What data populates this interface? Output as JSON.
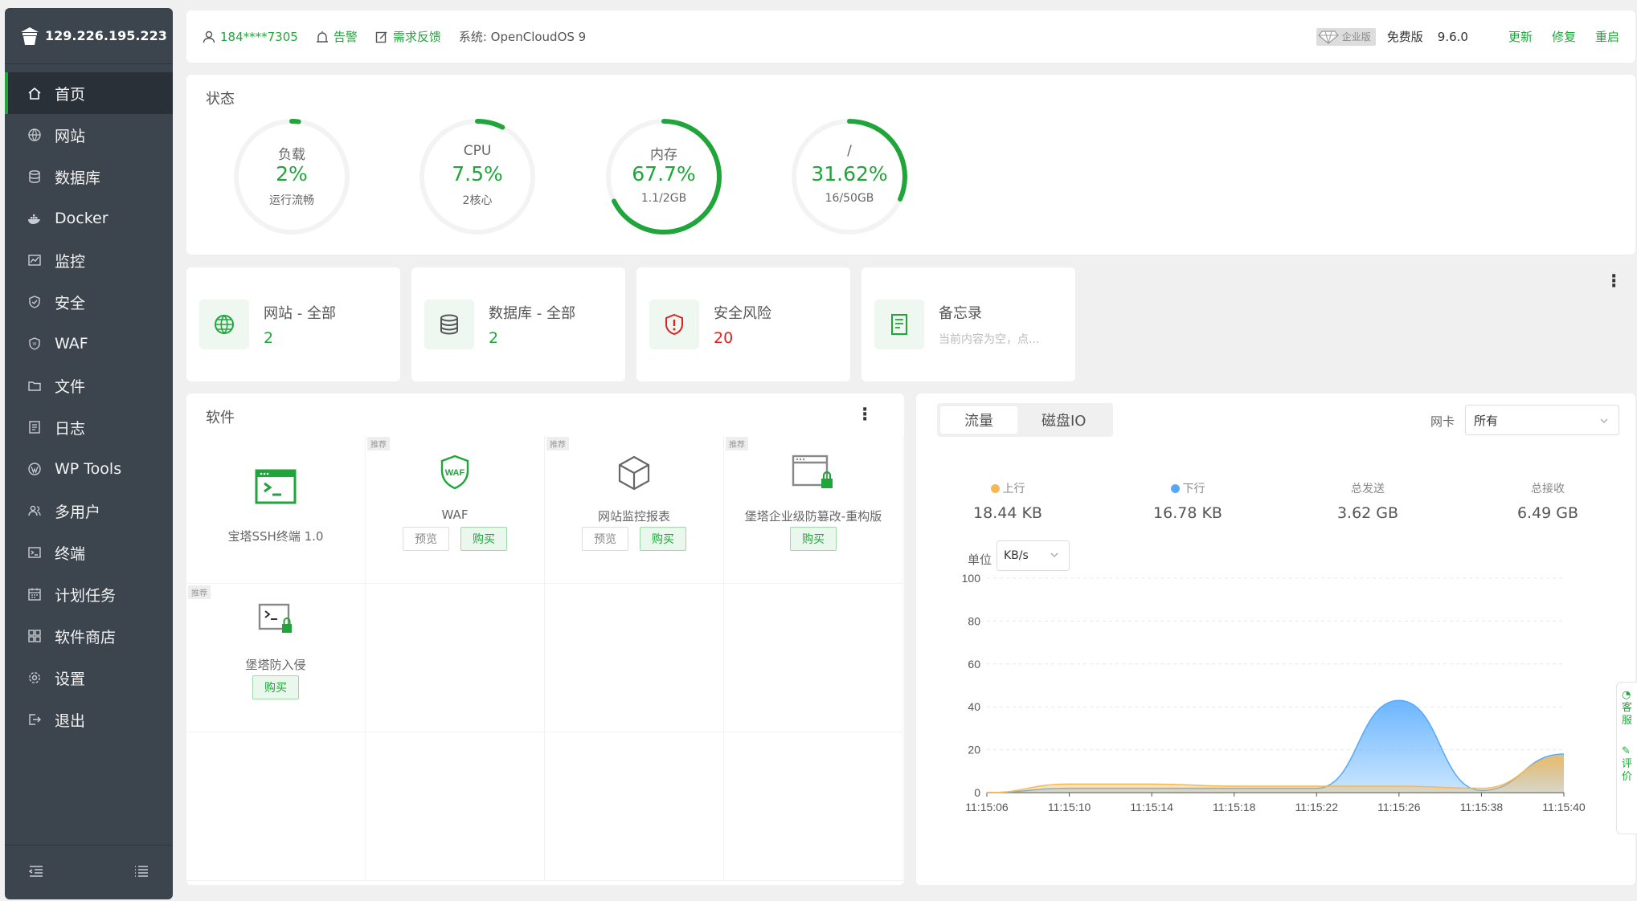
{
  "sidebar": {
    "ip": "129.226.195.223",
    "badge": "0",
    "items": [
      {
        "label": "首页",
        "icon": "home-icon"
      },
      {
        "label": "网站",
        "icon": "globe-icon"
      },
      {
        "label": "数据库",
        "icon": "database-icon"
      },
      {
        "label": "Docker",
        "icon": "docker-icon"
      },
      {
        "label": "监控",
        "icon": "monitor-icon"
      },
      {
        "label": "安全",
        "icon": "shield-icon"
      },
      {
        "label": "WAF",
        "icon": "waf-icon"
      },
      {
        "label": "文件",
        "icon": "folder-icon"
      },
      {
        "label": "日志",
        "icon": "log-icon"
      },
      {
        "label": "WP Tools",
        "icon": "wordpress-icon"
      },
      {
        "label": "多用户",
        "icon": "users-icon"
      },
      {
        "label": "终端",
        "icon": "terminal-icon"
      },
      {
        "label": "计划任务",
        "icon": "calendar-icon"
      },
      {
        "label": "软件商店",
        "icon": "apps-icon"
      },
      {
        "label": "设置",
        "icon": "gear-icon"
      },
      {
        "label": "退出",
        "icon": "logout-icon"
      }
    ]
  },
  "topbar": {
    "user": "184****7305",
    "alarm": "告警",
    "feedback": "需求反馈",
    "system": "系统:  OpenCloudOS 9",
    "enterprise": "企业版",
    "free": "免费版",
    "version": "9.6.0",
    "update": "更新",
    "repair": "修复",
    "restart": "重启"
  },
  "status": {
    "title": "状态",
    "gauges": [
      {
        "label": "负载",
        "value": "2%",
        "sub": "运行流畅",
        "fraction": 0.02
      },
      {
        "label": "CPU",
        "value": "7.5%",
        "sub": "2核心",
        "fraction": 0.075
      },
      {
        "label": "内存",
        "value": "67.7%",
        "sub": "1.1/2GB",
        "fraction": 0.677
      },
      {
        "label": "/",
        "value": "31.62%",
        "sub": "16/50GB",
        "fraction": 0.3162
      }
    ]
  },
  "overview": [
    {
      "title": "网站 - 全部",
      "value": "2",
      "icon": "globe-icon"
    },
    {
      "title": "数据库 - 全部",
      "value": "2",
      "icon": "database-icon"
    },
    {
      "title": "安全风险",
      "value": "20",
      "icon": "shield-alert-icon"
    },
    {
      "title": "备忘录",
      "sub": "当前内容为空，点...",
      "icon": "memo-icon"
    }
  ],
  "software": {
    "title": "软件",
    "recommend": "推荐",
    "preview": "预览",
    "buy": "购买",
    "items": [
      {
        "name": "宝塔SSH终端 1.0",
        "icon": "terminal-app-icon"
      },
      {
        "name": "WAF",
        "icon": "waf-shield-icon"
      },
      {
        "name": "网站监控报表",
        "icon": "cube-icon"
      },
      {
        "name": "堡塔企业级防篡改-重构版",
        "icon": "tamper-lock-icon"
      },
      {
        "name": "堡塔防入侵",
        "icon": "intrusion-lock-icon"
      }
    ]
  },
  "traffic": {
    "tabs": [
      "流量",
      "磁盘IO"
    ],
    "nic_label": "网卡",
    "nic_value": "所有",
    "stats": [
      {
        "label": "上行",
        "value": "18.44 KB",
        "color": "#f7b851"
      },
      {
        "label": "下行",
        "value": "16.78 KB",
        "color": "#52a9ff"
      },
      {
        "label": "总发送",
        "value": "3.62 GB"
      },
      {
        "label": "总接收",
        "value": "6.49 GB"
      }
    ],
    "unit_label": "单位",
    "unit_value": "KB/s"
  },
  "chart_data": {
    "type": "area",
    "x": [
      "11:15:06",
      "11:15:10",
      "11:15:14",
      "11:15:18",
      "11:15:22",
      "11:15:26",
      "11:15:38",
      "11:15:40"
    ],
    "ylim": [
      0,
      100
    ],
    "yticks": [
      0,
      20,
      40,
      60,
      80,
      100
    ],
    "grid": true,
    "series": [
      {
        "name": "上行",
        "color": "#f7b851",
        "values": [
          0,
          4,
          4,
          3,
          3,
          3,
          2,
          17
        ]
      },
      {
        "name": "下行",
        "color": "#52a9ff",
        "values": [
          0,
          2,
          2,
          2,
          2,
          43,
          1,
          18
        ]
      }
    ]
  },
  "float_helper": {
    "line1": "客服",
    "line2": "评价"
  }
}
